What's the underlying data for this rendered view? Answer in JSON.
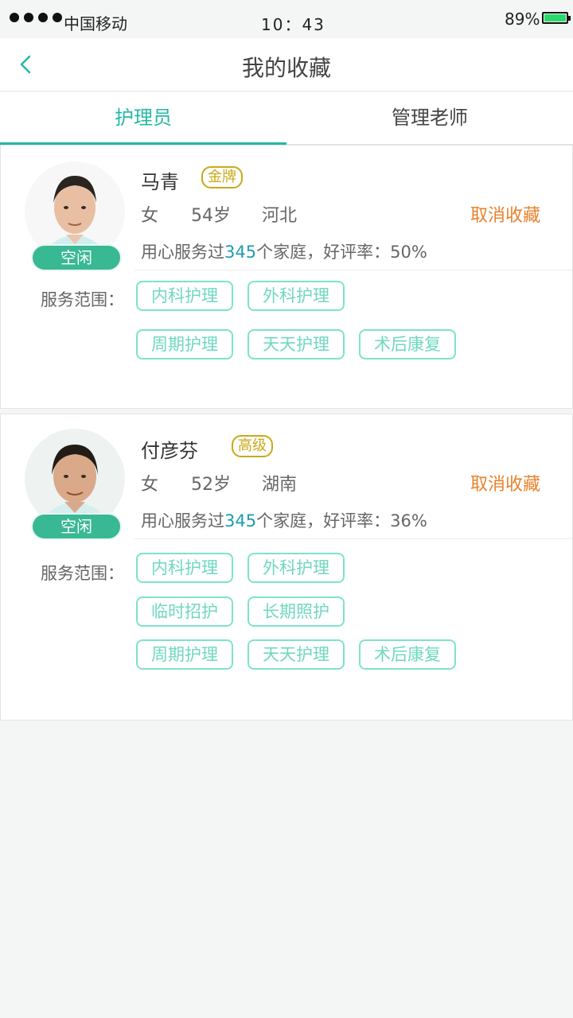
{
  "status_bar": {
    "carrier": "中国移动",
    "time": "10：43",
    "battery": "89%"
  },
  "nav": {
    "title": "我的收藏",
    "back_icon": "chevron-left-icon"
  },
  "tabs": [
    {
      "label": "护理员",
      "active": true
    },
    {
      "label": "管理老师",
      "active": false
    }
  ],
  "caregivers": [
    {
      "name": "马青",
      "level": "金牌",
      "status": "空闲",
      "gender": "女",
      "age": "54岁",
      "region": "河北",
      "cancel_label": "取消收藏",
      "stat_prefix": "用心服务过",
      "families": "345",
      "stat_suffix": "个家庭，好评率：50%",
      "scope_label": "服务范围：",
      "services": [
        "内科护理",
        "外科护理",
        "周期护理",
        "天天护理",
        "术后康复"
      ]
    },
    {
      "name": "付彦芬",
      "level": "高级",
      "status": "空闲",
      "gender": "女",
      "age": "52岁",
      "region": "湖南",
      "cancel_label": "取消收藏",
      "stat_prefix": "用心服务过",
      "families": "345",
      "stat_suffix": "个家庭，好评率：36%",
      "scope_label": "服务范围：",
      "services": [
        "内科护理",
        "外科护理",
        "临时招护",
        "长期照护",
        "周期护理",
        "天天护理",
        "术后康复"
      ]
    }
  ],
  "colors": {
    "accent": "#26b8a6",
    "status_green": "#39b894",
    "level_gold": "#c9a918",
    "cancel_orange": "#e8822c",
    "tag_border": "#7fe2cb",
    "highlight_number": "#1f9bb3"
  }
}
